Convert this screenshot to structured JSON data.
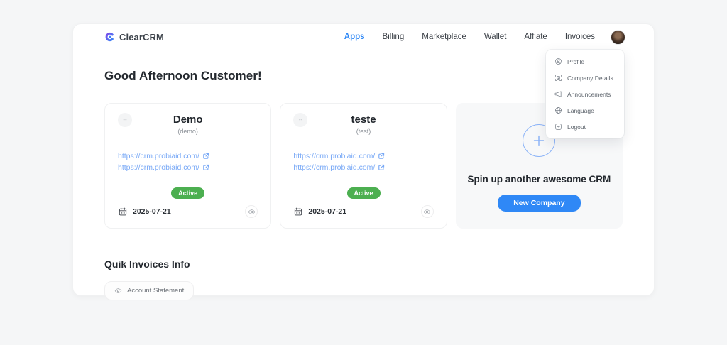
{
  "header": {
    "brand": "ClearCRM",
    "nav": [
      {
        "label": "Apps",
        "active": true
      },
      {
        "label": "Billing",
        "active": false
      },
      {
        "label": "Marketplace",
        "active": false
      },
      {
        "label": "Wallet",
        "active": false
      },
      {
        "label": "Affiate",
        "active": false
      },
      {
        "label": "Invoices",
        "active": false
      }
    ]
  },
  "user_menu": {
    "items": [
      {
        "icon": "profile-icon",
        "label": "Profile"
      },
      {
        "icon": "company-details-icon",
        "label": "Company Details"
      },
      {
        "icon": "announcements-icon",
        "label": "Announcements"
      },
      {
        "icon": "language-icon",
        "label": "Language"
      },
      {
        "icon": "logout-icon",
        "label": "Logout"
      }
    ]
  },
  "main": {
    "greeting": "Good Afternoon Customer!",
    "companies": [
      {
        "name": "Demo",
        "subtitle": "(demo)",
        "links": [
          "https://crm.probiaid.com/",
          "https://crm.probiaid.com/"
        ],
        "status": "Active",
        "date": "2025-07-21"
      },
      {
        "name": "teste",
        "subtitle": "(test)",
        "links": [
          "https://crm.probiaid.com/",
          "https://crm.probiaid.com/"
        ],
        "status": "Active",
        "date": "2025-07-21"
      }
    ],
    "new_company": {
      "title": "Spin up another awesome CRM",
      "button_label": "New Company"
    },
    "invoices": {
      "title": "Quik Invoices Info",
      "account_statement_label": "Account Statement"
    }
  },
  "colors": {
    "accent_blue": "#2f88f6",
    "link_blue": "#79a9f6",
    "status_green": "#4caf50",
    "background": "#f5f6f7"
  }
}
